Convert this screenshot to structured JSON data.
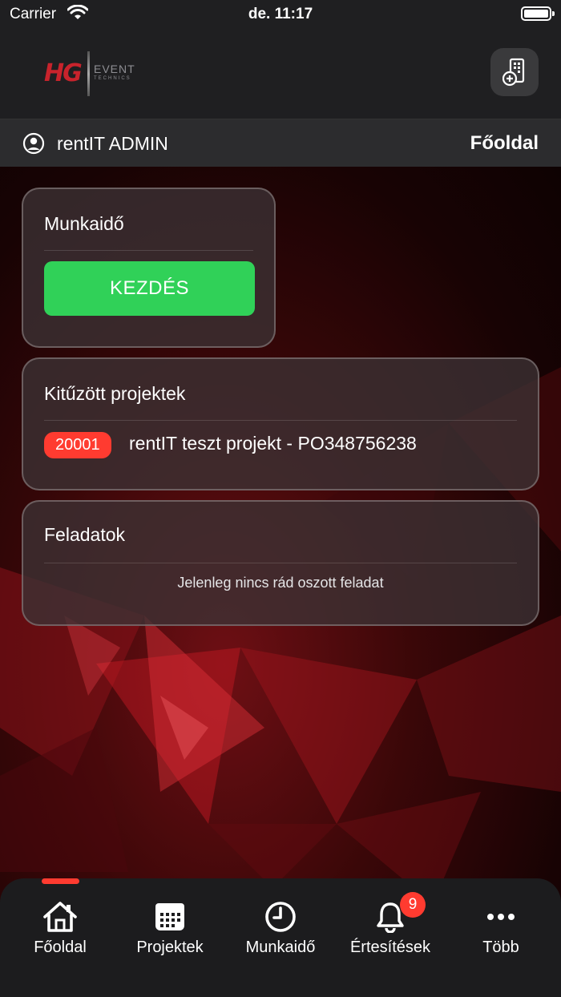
{
  "status_bar": {
    "carrier": "Carrier",
    "time": "de. 11:17"
  },
  "header": {
    "logo": {
      "mark": "HG",
      "word": "EVENT",
      "sub": "TECHNICS"
    },
    "scan_icon": "doc-scanner-add-icon"
  },
  "user_row": {
    "user_name": "rentIT ADMIN",
    "page_title": "Főoldal"
  },
  "cards": {
    "worktime": {
      "title": "Munkaidő",
      "button_label": "KEZDÉS"
    },
    "pinned": {
      "title": "Kitűzött projektek",
      "projects": [
        {
          "id": "20001",
          "name": "rentIT teszt projekt - PO348756238"
        }
      ]
    },
    "tasks": {
      "title": "Feladatok",
      "empty_text": "Jelenleg nincs rád oszott feladat"
    }
  },
  "tab_bar": {
    "active_index": 0,
    "tabs": [
      {
        "label": "Főoldal",
        "icon": "home-icon"
      },
      {
        "label": "Projektek",
        "icon": "calendar-icon"
      },
      {
        "label": "Munkaidő",
        "icon": "clock-icon"
      },
      {
        "label": "Értesítések",
        "icon": "bell-icon",
        "badge": "9"
      },
      {
        "label": "Több",
        "icon": "more-icon"
      }
    ]
  },
  "colors": {
    "accent_red": "#ff3b30",
    "start_green": "#30d158"
  }
}
